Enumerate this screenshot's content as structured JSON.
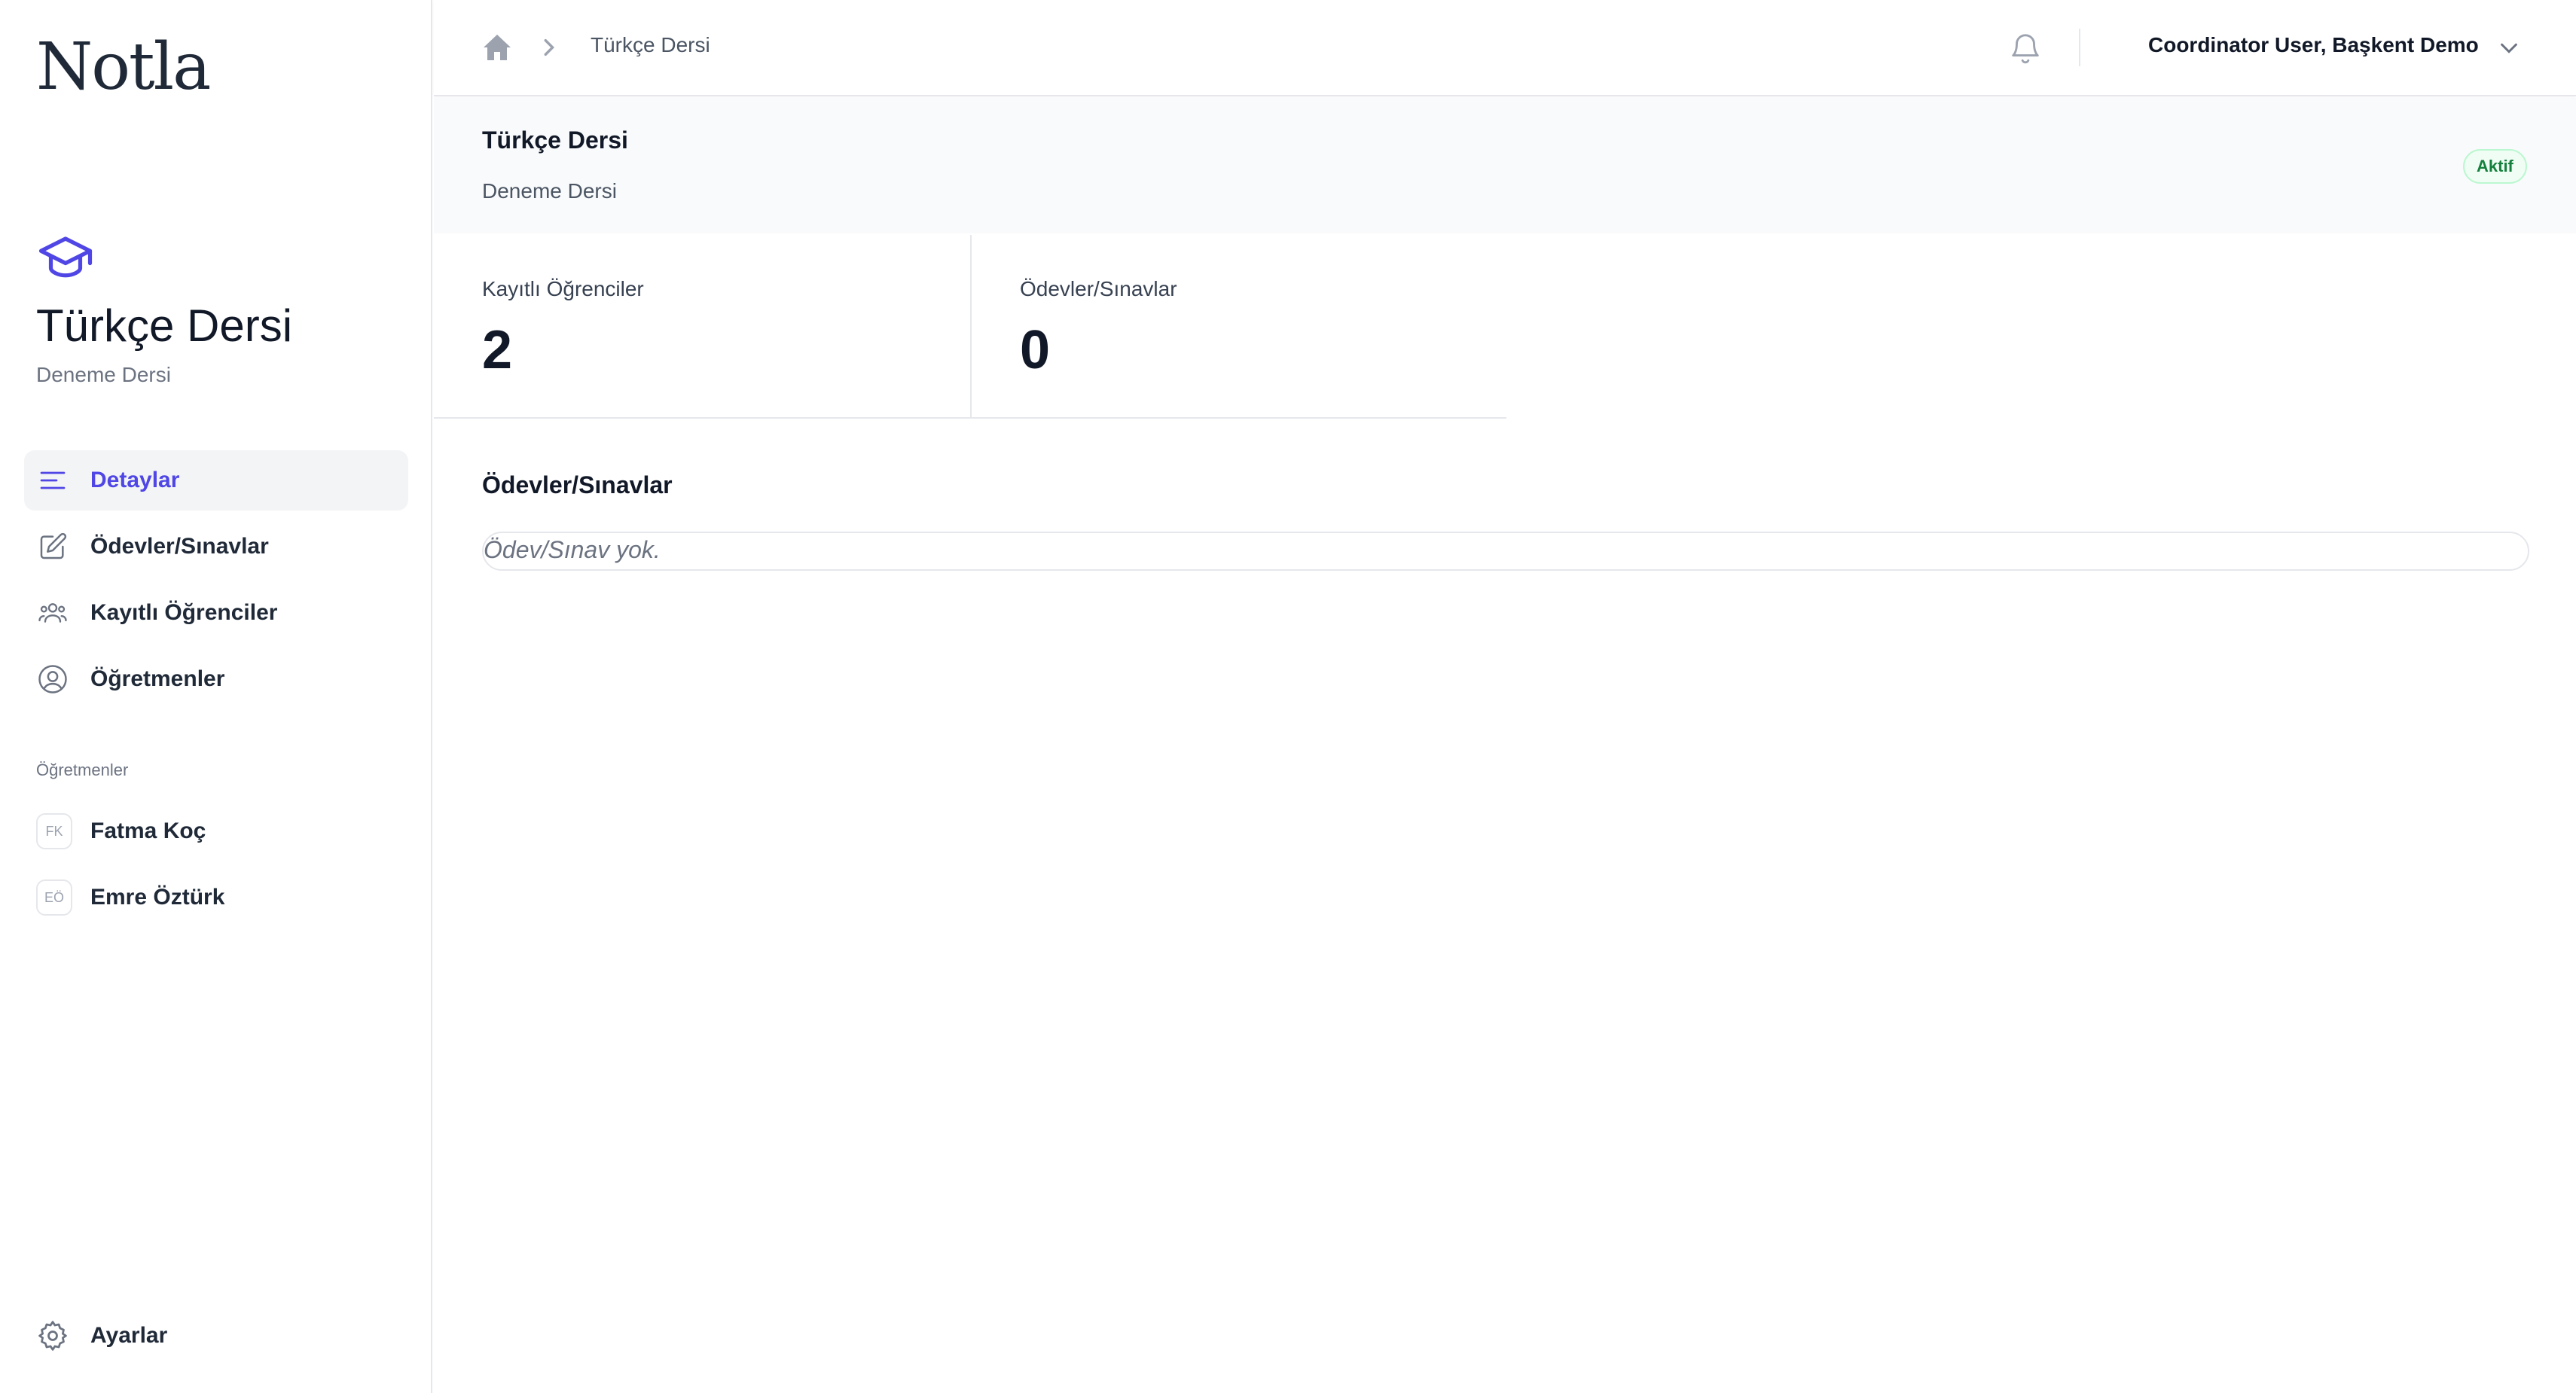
{
  "app": {
    "logo": "Notla"
  },
  "sidebar": {
    "course_title": "Türkçe Dersi",
    "course_subtitle": "Deneme Dersi",
    "nav": [
      {
        "label": "Detaylar",
        "icon": "menu-lines-icon",
        "active": true
      },
      {
        "label": "Ödevler/Sınavlar",
        "icon": "edit-icon"
      },
      {
        "label": "Kayıtlı Öğrenciler",
        "icon": "users-icon"
      },
      {
        "label": "Öğretmenler",
        "icon": "user-circle-icon"
      }
    ],
    "teachers_section_label": "Öğretmenler",
    "teachers": [
      {
        "initials": "FK",
        "name": "Fatma Koç"
      },
      {
        "initials": "EÖ",
        "name": "Emre Öztürk"
      }
    ],
    "settings_label": "Ayarlar"
  },
  "topbar": {
    "breadcrumb": [
      "Türkçe Dersi"
    ],
    "user_label": "Coordinator User, Başkent Demo"
  },
  "header": {
    "title": "Türkçe Dersi",
    "subtitle": "Deneme Dersi",
    "status": "Aktif",
    "status_color": "#15803d"
  },
  "stats": [
    {
      "label": "Kayıtlı Öğrenciler",
      "value": "2"
    },
    {
      "label": "Ödevler/Sınavlar",
      "value": "0"
    }
  ],
  "assignments": {
    "title": "Ödevler/Sınavlar",
    "empty_text": "Ödev/Sınav yok."
  },
  "colors": {
    "accent": "#4f46e5",
    "text": "#111827",
    "muted": "#6b7280"
  }
}
